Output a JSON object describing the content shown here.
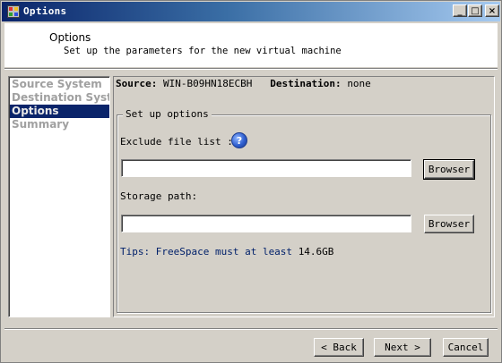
{
  "window": {
    "title": "Options"
  },
  "title_buttons": {
    "minimize": "_",
    "maximize": "□",
    "close": "×"
  },
  "header": {
    "title": "Options",
    "subtitle": "Set up the parameters for the new virtual machine"
  },
  "nav": {
    "items": [
      {
        "label": "Source System",
        "selected": false
      },
      {
        "label": "Destination System",
        "selected": false
      },
      {
        "label": "Options",
        "selected": true
      },
      {
        "label": "Summary",
        "selected": false
      }
    ]
  },
  "info": {
    "source_label": "Source:",
    "source_value": "WIN-B09HN18ECBH",
    "destination_label": "Destination:",
    "destination_value": "none"
  },
  "options": {
    "group_title": "Set up options",
    "exclude_label": "Exclude file list :",
    "help_glyph": "?",
    "exclude_value": "",
    "exclude_browse": "Browser",
    "storage_label": "Storage path:",
    "storage_value": "",
    "storage_browse": "Browser",
    "tips_label": "Tips: FreeSpace must at least",
    "tips_value": "14.6GB"
  },
  "footer": {
    "back": "< Back",
    "next": "Next >",
    "cancel": "Cancel"
  },
  "colors": {
    "titlebar_start": "#0a246a",
    "titlebar_end": "#a6caf0",
    "selection": "#0a246a",
    "face": "#d4d0c8",
    "tips_text": "#00206a"
  }
}
